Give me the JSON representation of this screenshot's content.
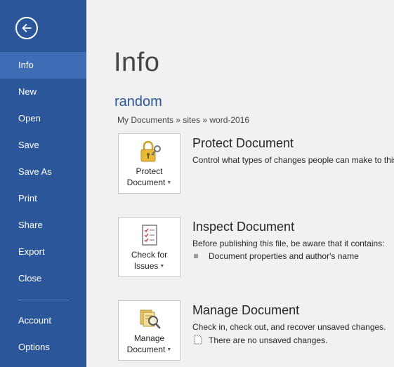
{
  "sidebar": {
    "items": [
      {
        "label": "Info",
        "active": true
      },
      {
        "label": "New"
      },
      {
        "label": "Open"
      },
      {
        "label": "Save"
      },
      {
        "label": "Save As"
      },
      {
        "label": "Print"
      },
      {
        "label": "Share"
      },
      {
        "label": "Export"
      },
      {
        "label": "Close"
      },
      {
        "label": "Account"
      },
      {
        "label": "Options"
      }
    ]
  },
  "main": {
    "title": "Info",
    "doc_name": "random",
    "breadcrumb": "My Documents » sites » word-2016",
    "sections": [
      {
        "button_line1": "Protect",
        "button_line2": "Document",
        "title": "Protect Document",
        "desc": "Control what types of changes people can make to this document."
      },
      {
        "button_line1": "Check for",
        "button_line2": "Issues",
        "title": "Inspect Document",
        "desc": "Before publishing this file, be aware that it contains:",
        "bullet": "Document properties and author's name"
      },
      {
        "button_line1": "Manage",
        "button_line2": "Document",
        "title": "Manage Document",
        "desc": "Check in, check out, and recover unsaved changes.",
        "note": "There are no unsaved changes."
      }
    ]
  },
  "colors": {
    "accent": "#2b579a",
    "active": "#3e6db5",
    "background": "#f1f1f1"
  }
}
